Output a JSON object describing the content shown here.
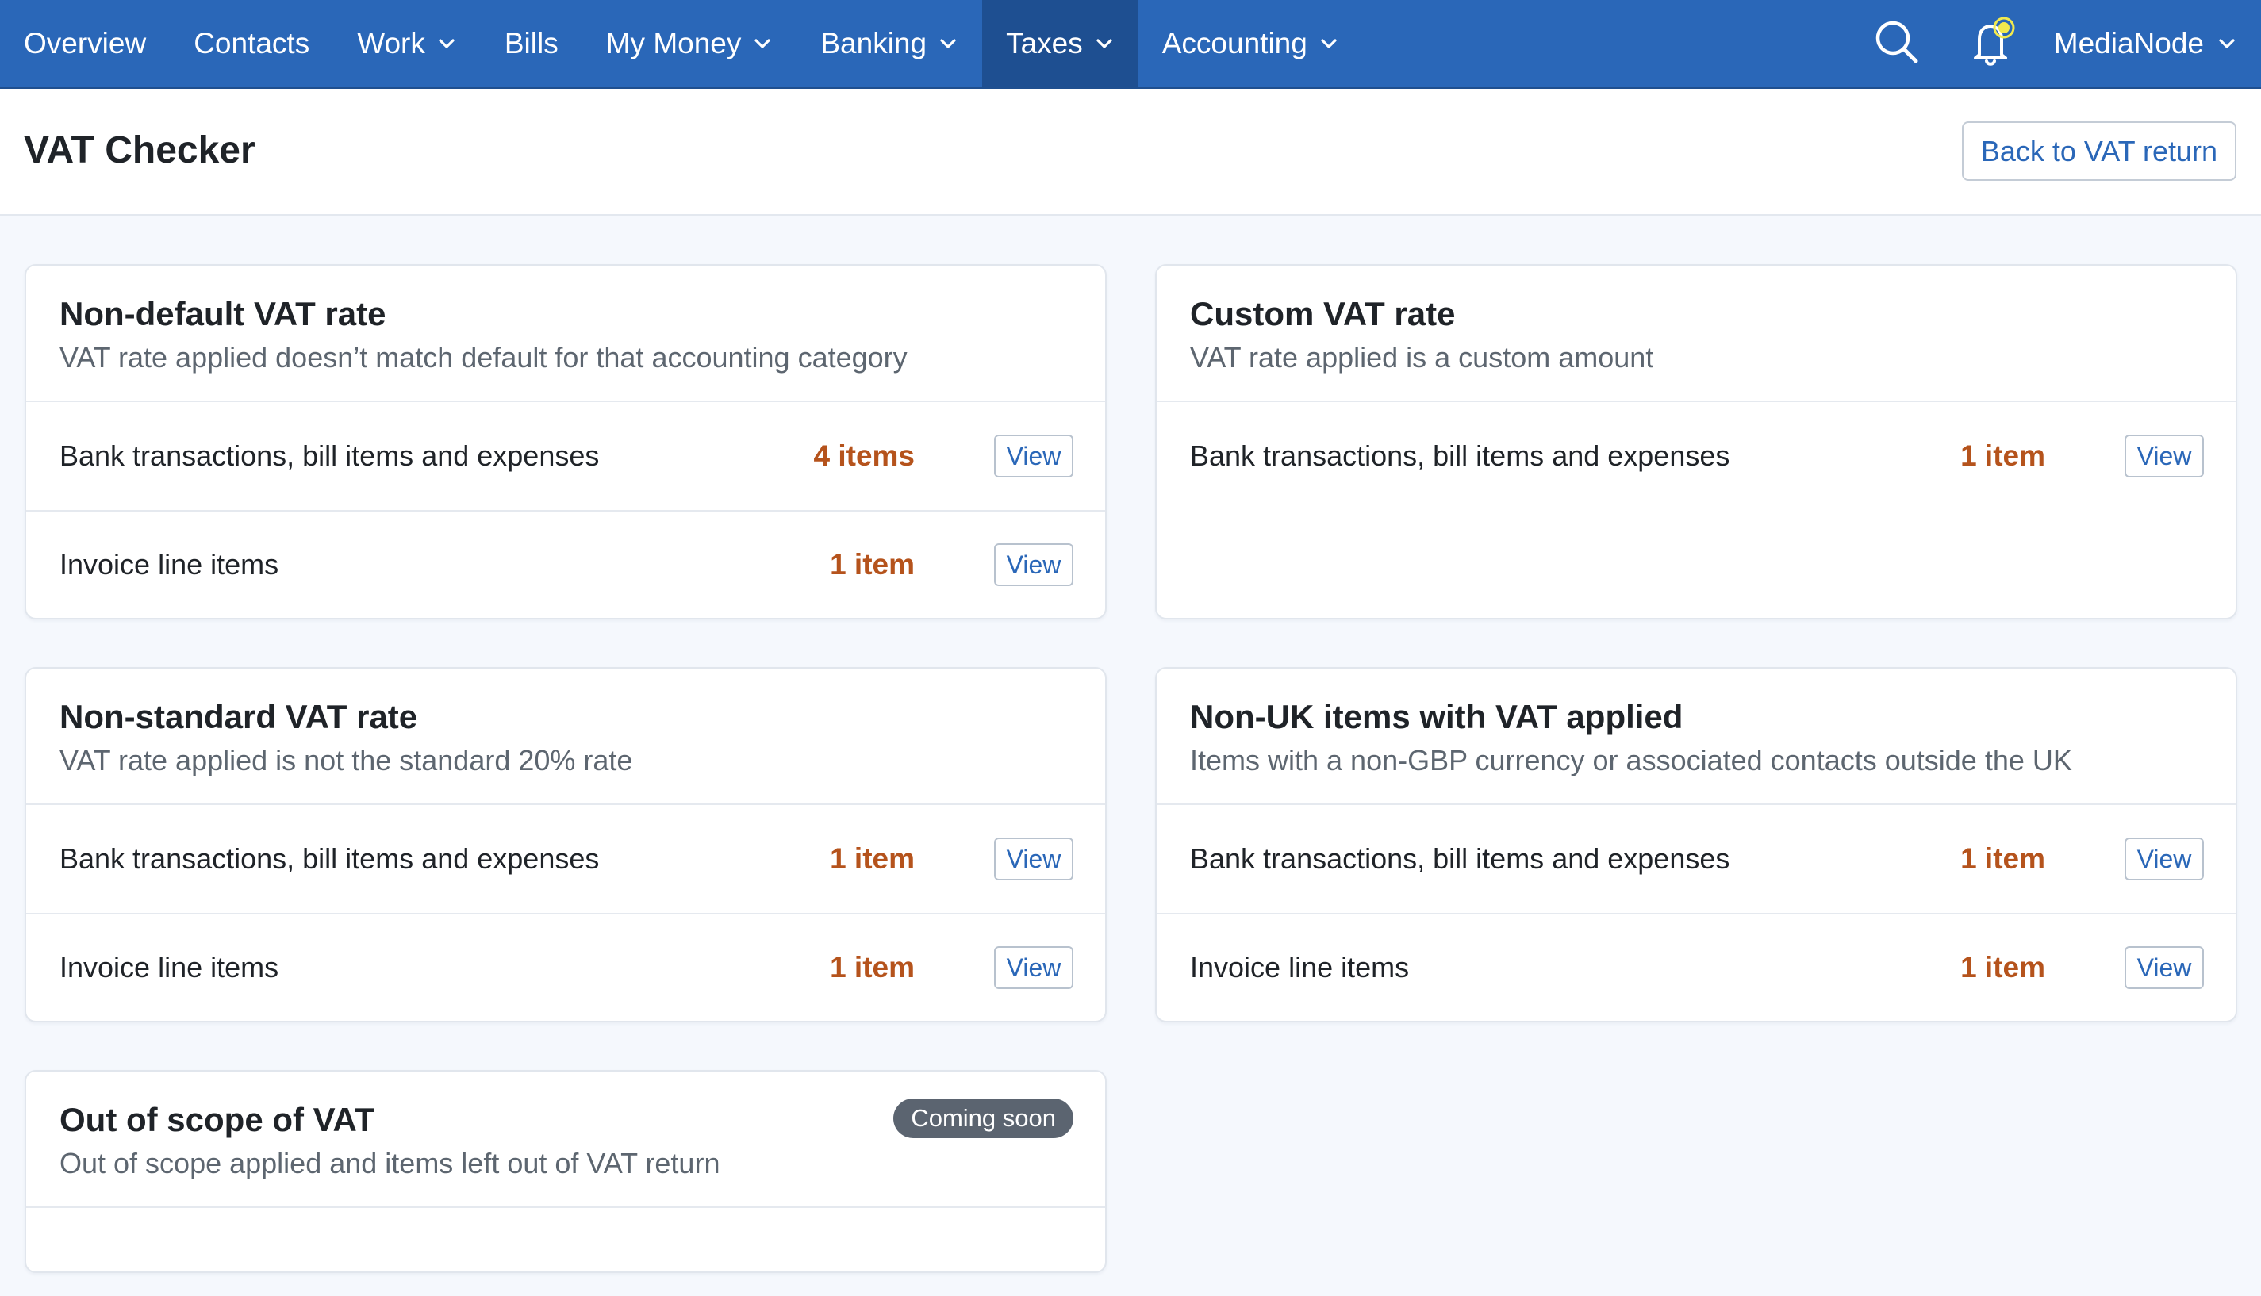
{
  "nav": {
    "items": [
      {
        "label": "Overview",
        "dropdown": false,
        "active": false
      },
      {
        "label": "Contacts",
        "dropdown": false,
        "active": false
      },
      {
        "label": "Work",
        "dropdown": true,
        "active": false
      },
      {
        "label": "Bills",
        "dropdown": false,
        "active": false
      },
      {
        "label": "My Money",
        "dropdown": true,
        "active": false
      },
      {
        "label": "Banking",
        "dropdown": true,
        "active": false
      },
      {
        "label": "Taxes",
        "dropdown": true,
        "active": true
      },
      {
        "label": "Accounting",
        "dropdown": true,
        "active": false
      }
    ],
    "search_icon": "search-icon",
    "notification_icon": "bell-icon",
    "account_name": "MediaNode"
  },
  "page": {
    "title": "VAT Checker",
    "back_label": "Back to VAT return"
  },
  "cards": {
    "non_default": {
      "title": "Non-default VAT rate",
      "subtitle": "VAT rate applied doesn’t match default for that accounting category",
      "rows": [
        {
          "label": "Bank transactions, bill items and expenses",
          "count": "4 items",
          "action": "View"
        },
        {
          "label": "Invoice line items",
          "count": "1 item",
          "action": "View"
        }
      ]
    },
    "custom": {
      "title": "Custom VAT rate",
      "subtitle": "VAT rate applied is a custom amount",
      "rows": [
        {
          "label": "Bank transactions, bill items and expenses",
          "count": "1 item",
          "action": "View"
        }
      ]
    },
    "non_standard": {
      "title": "Non-standard VAT rate",
      "subtitle": "VAT rate applied is not the standard 20% rate",
      "rows": [
        {
          "label": "Bank transactions, bill items and expenses",
          "count": "1 item",
          "action": "View"
        },
        {
          "label": "Invoice line items",
          "count": "1 item",
          "action": "View"
        }
      ]
    },
    "non_uk": {
      "title": "Non-UK items with VAT applied",
      "subtitle": "Items with a non-GBP currency or associated contacts outside the UK",
      "rows": [
        {
          "label": "Bank transactions, bill items and expenses",
          "count": "1 item",
          "action": "View"
        },
        {
          "label": "Invoice line items",
          "count": "1 item",
          "action": "View"
        }
      ]
    },
    "out_of_scope": {
      "title": "Out of scope of VAT",
      "subtitle": "Out of scope applied and items left out of VAT return",
      "badge": "Coming soon"
    }
  },
  "colors": {
    "nav_bg": "#2a67b8",
    "nav_active_bg": "#1e4f91",
    "link": "#2a67b8",
    "count": "#b5531c",
    "badge_bg": "#5b6470",
    "notification_dot": "#f2e94e"
  }
}
